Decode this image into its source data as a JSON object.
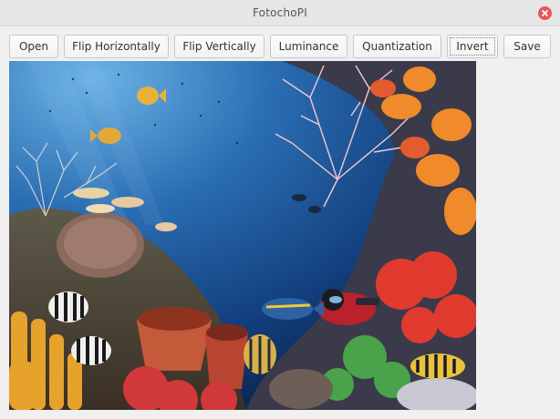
{
  "window": {
    "title": "FotochoPI"
  },
  "toolbar": {
    "open": "Open",
    "flip_h": "Flip Horizontally",
    "flip_v": "Flip Vertically",
    "luminance": "Luminance",
    "quantization": "Quantization",
    "invert": "Invert",
    "save": "Save"
  },
  "icons": {
    "close": "close-icon"
  },
  "colors": {
    "close": "#e9545a",
    "water_top": "#3e86c6",
    "water_bottom": "#0a2a5a"
  }
}
